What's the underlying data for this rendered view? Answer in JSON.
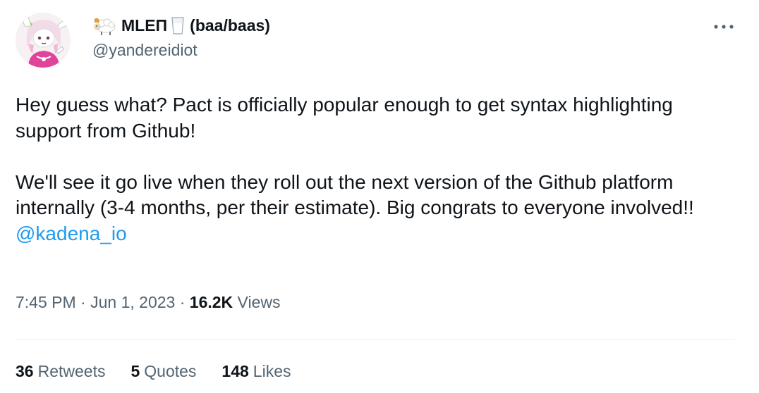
{
  "tweet": {
    "author": {
      "display_name": "MLEΠ",
      "name_suffix": "(baa/baas)",
      "handle": "@yandereidiot",
      "name_icons": [
        "ram-icon",
        "glass-of-milk-icon"
      ]
    },
    "more_icon": "more-options-icon",
    "body": {
      "paragraph_1": "Hey guess what? Pact is officially popular enough to get syntax highlighting support from Github!",
      "paragraph_2": "We'll see it go live when they roll out the next version of the Github platform internally (3-4 months, per their estimate). Big congrats to everyone involved!! ",
      "mention": "@kadena_io"
    },
    "meta": {
      "time": "7:45 PM",
      "separator": " · ",
      "date": "Jun 1, 2023",
      "views_count": "16.2K",
      "views_label": " Views"
    },
    "stats": [
      {
        "count": "36",
        "label": "Retweets"
      },
      {
        "count": "5",
        "label": "Quotes"
      },
      {
        "count": "148",
        "label": "Likes"
      }
    ],
    "colors": {
      "text": "#0f1419",
      "secondary": "#536471",
      "link": "#1d9bf0",
      "divider": "#eff3f4"
    }
  }
}
